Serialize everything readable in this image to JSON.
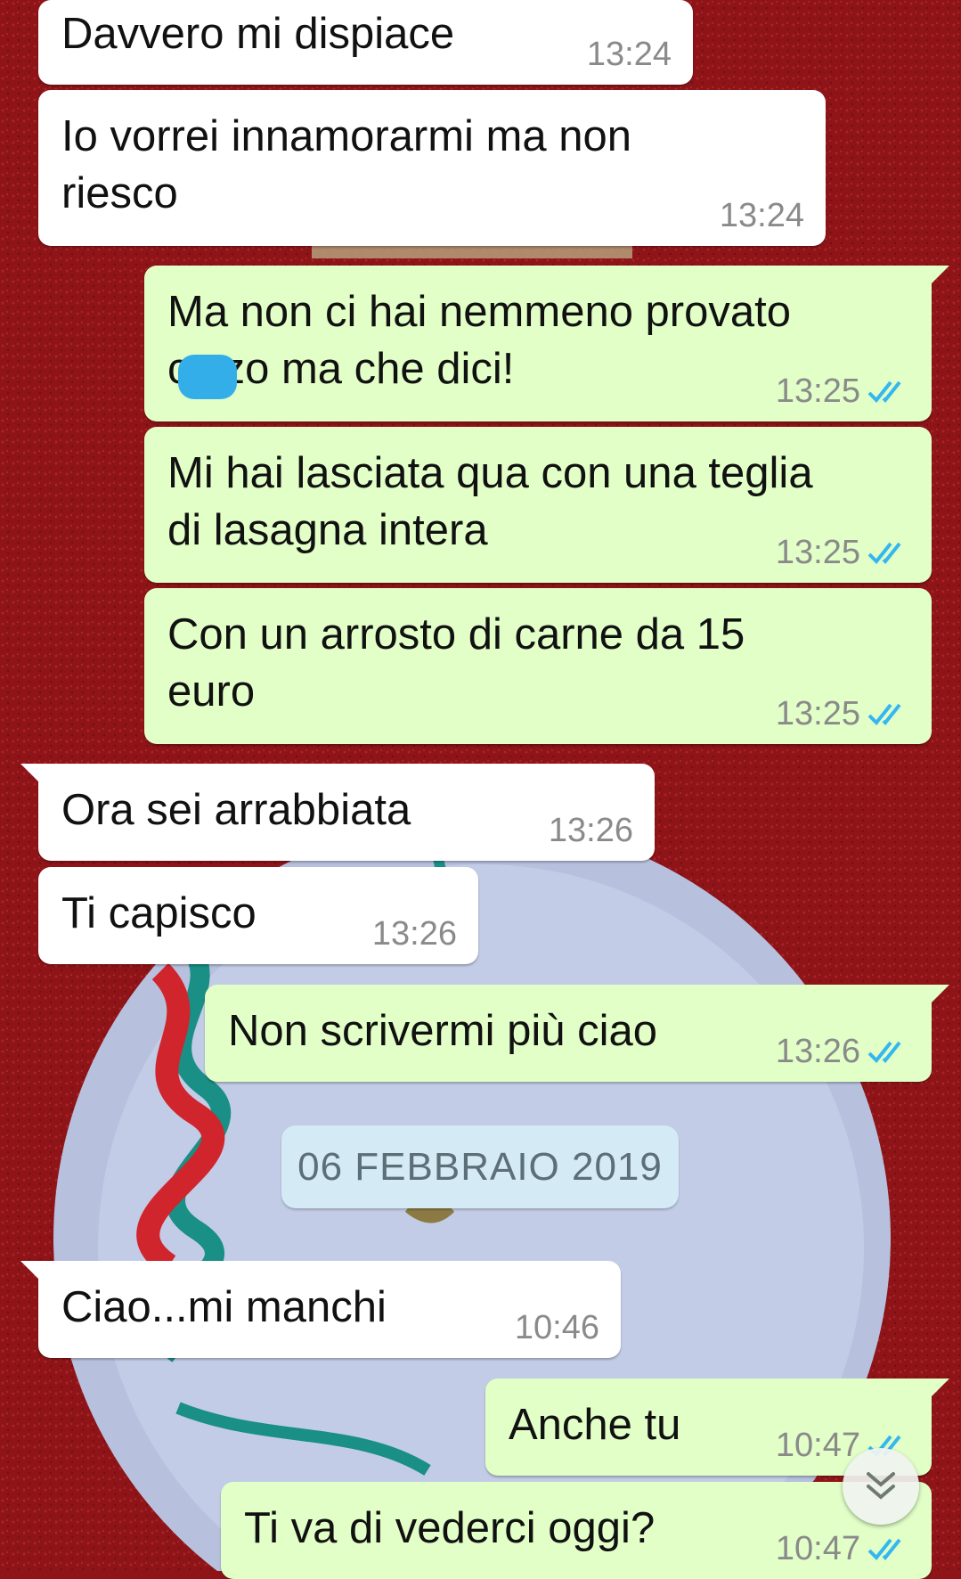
{
  "colors": {
    "incoming_bubble": "#ffffff",
    "outgoing_bubble": "#e1ffc7",
    "read_ticks": "#34b7f1",
    "timestamp": "#8a8a8a",
    "date_chip": "#d4eaf5",
    "redaction": "#33aee8",
    "wallpaper_red": "#8e1418"
  },
  "messages": [
    {
      "direction": "incoming",
      "text": "Davvero mi dispiace",
      "time": "13:24"
    },
    {
      "direction": "incoming",
      "text": "Io vorrei innamorarmi ma non\nriesco",
      "time": "13:24"
    },
    {
      "direction": "outgoing",
      "text": "Ma non ci hai nemmeno provato\nc   zzo ma che dici!",
      "time": "13:25",
      "status": "read",
      "redacted": true
    },
    {
      "direction": "outgoing",
      "text": "Mi hai lasciata qua con una teglia\ndi lasagna intera",
      "time": "13:25",
      "status": "read"
    },
    {
      "direction": "outgoing",
      "text": "Con un arrosto di carne da 15\neuro",
      "time": "13:25",
      "status": "read"
    },
    {
      "direction": "incoming",
      "text": "Ora sei arrabbiata",
      "time": "13:26"
    },
    {
      "direction": "incoming",
      "text": "Ti capisco",
      "time": "13:26"
    },
    {
      "direction": "outgoing",
      "text": "Non scrivermi più ciao",
      "time": "13:26",
      "status": "read"
    },
    {
      "direction": "incoming",
      "text": "Ciao...mi manchi",
      "time": "10:46"
    },
    {
      "direction": "outgoing",
      "text": "Anche tu",
      "time": "10:47",
      "status": "read"
    },
    {
      "direction": "outgoing",
      "text": "Ti va di vederci oggi?",
      "time": "10:47",
      "status": "read"
    }
  ],
  "date_separator": "06 FEBBRAIO 2019",
  "icons": {
    "read_receipt": "double-check-icon",
    "scroll_down": "double-chevron-down-icon"
  }
}
